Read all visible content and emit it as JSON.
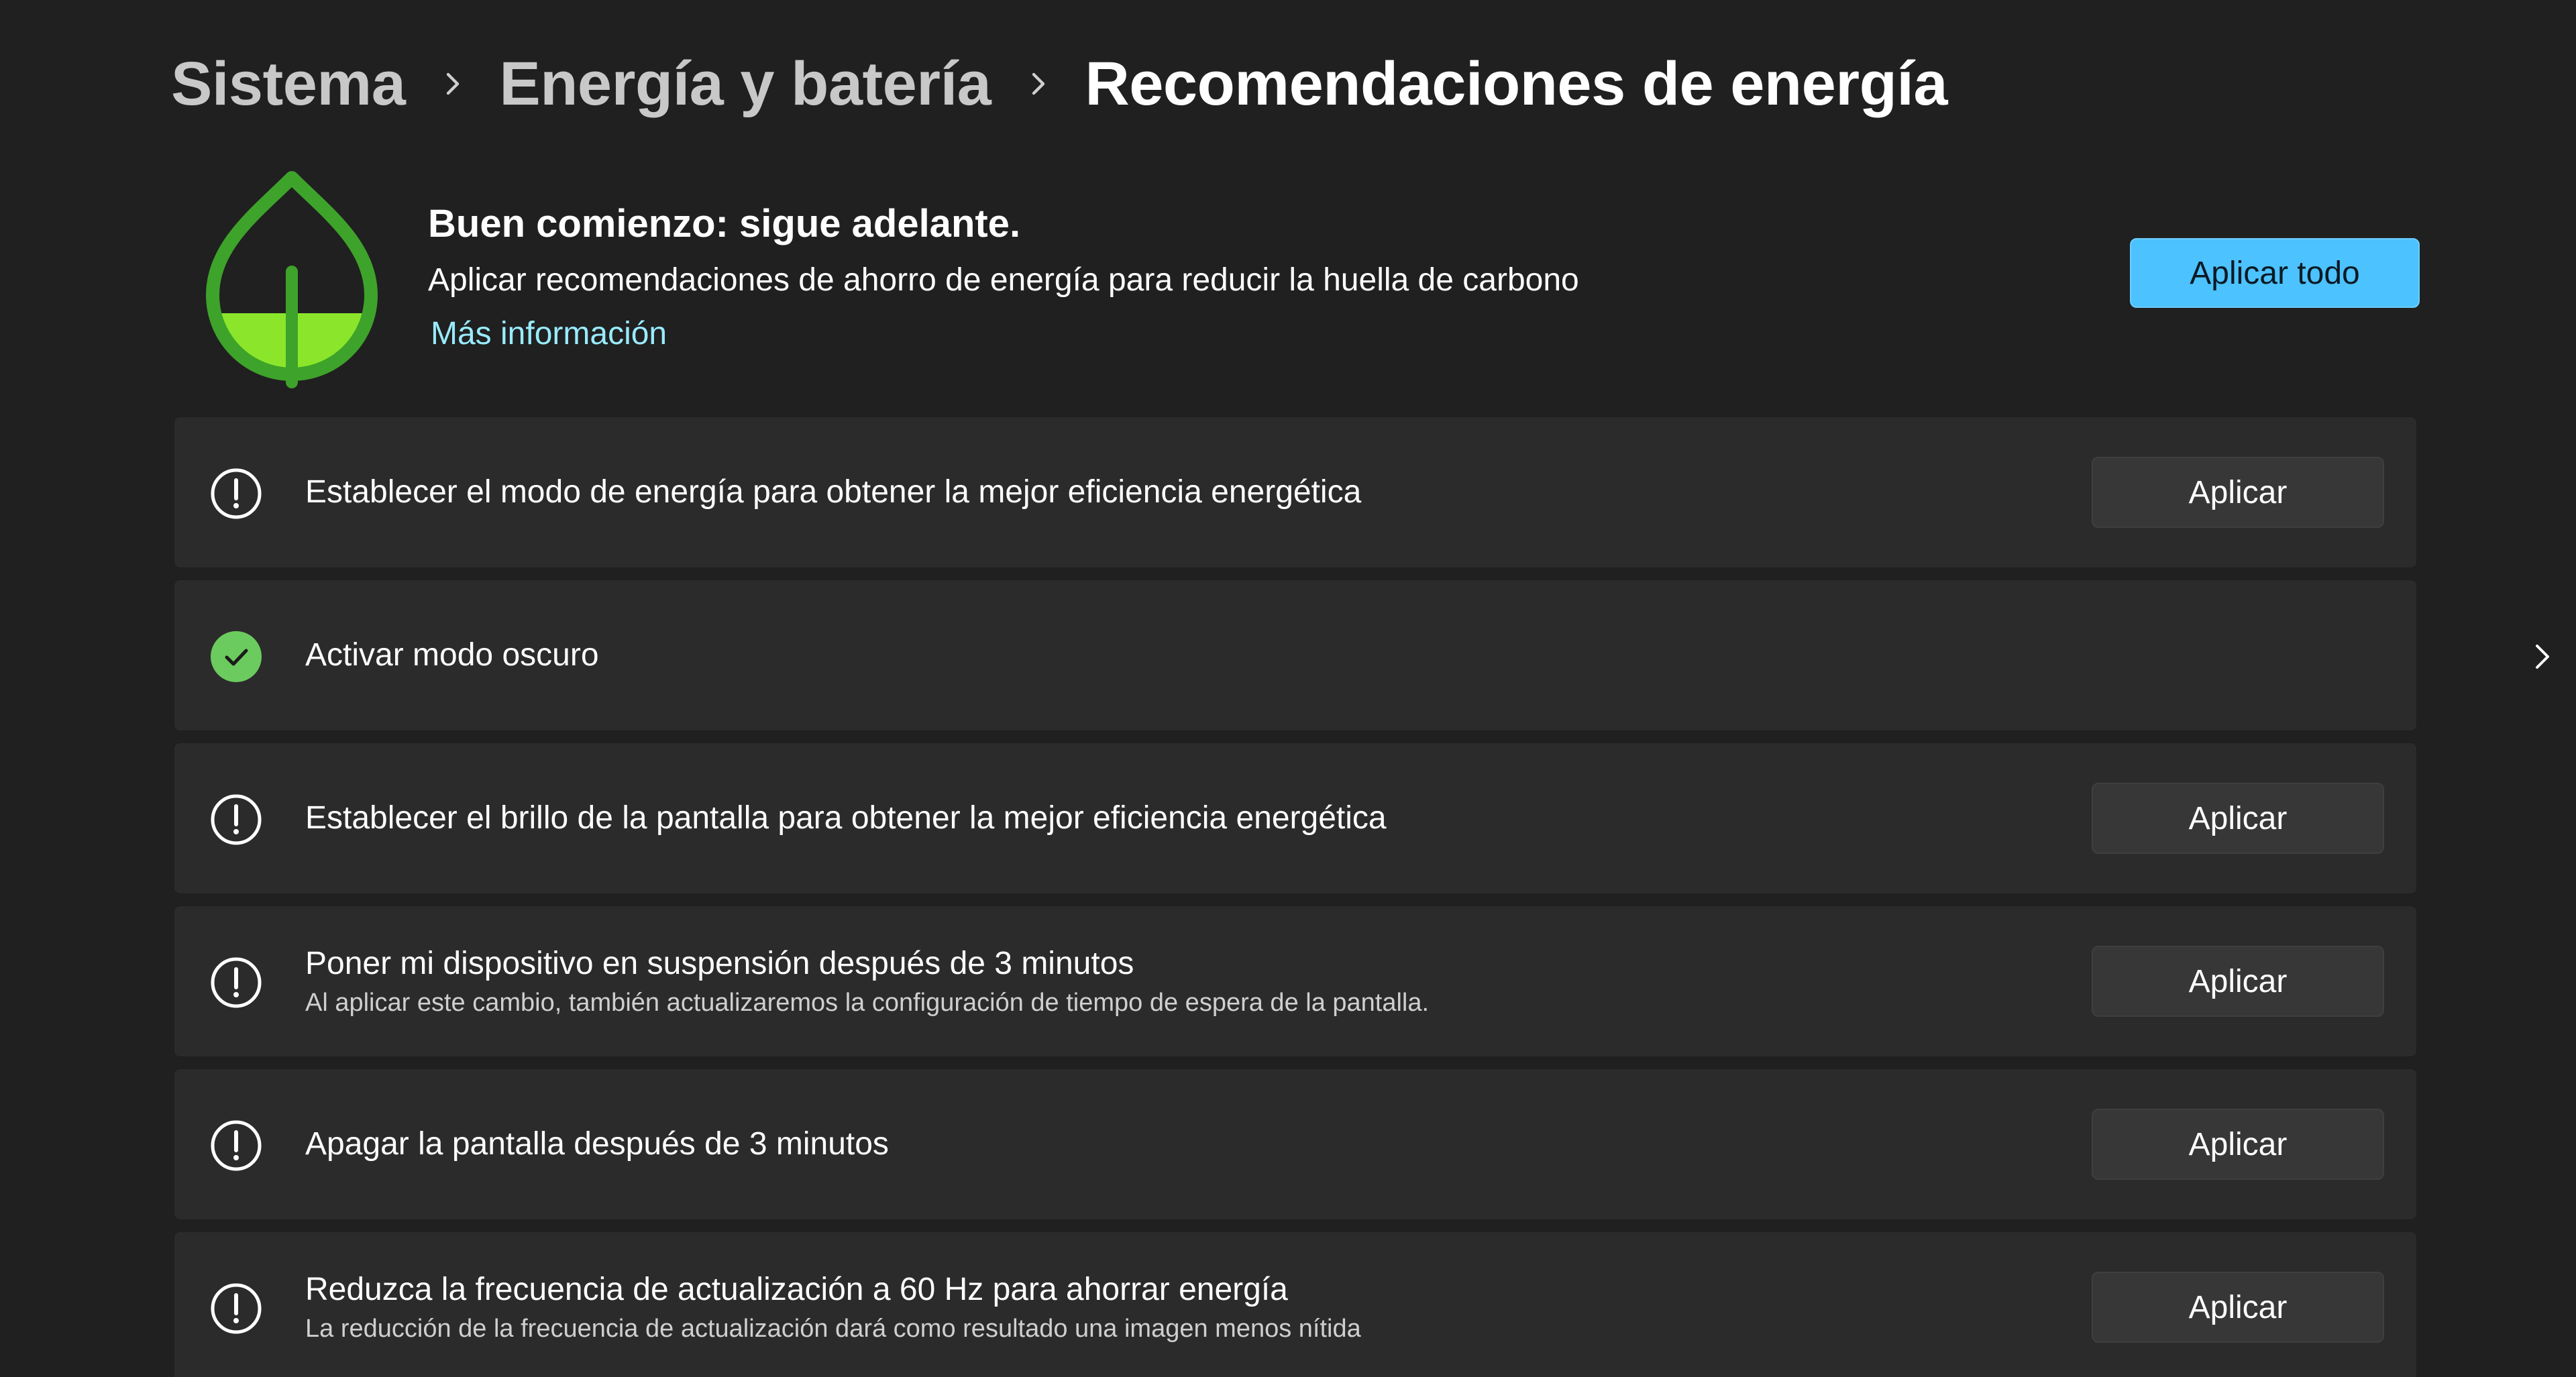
{
  "breadcrumb": {
    "items": [
      "Sistema",
      "Energía y batería",
      "Recomendaciones de energía"
    ]
  },
  "banner": {
    "title": "Buen comienzo: sigue adelante.",
    "description": "Aplicar recomendaciones de ahorro de energía para reducir la huella de carbono",
    "link": "Más información",
    "apply_all_label": "Aplicar todo",
    "icon": "leaf-icon"
  },
  "recommendations": [
    {
      "title": "Establecer el modo de energía para obtener la mejor eficiencia energética",
      "status": "pending",
      "icon": "warning-circle-icon",
      "action": "Aplicar"
    },
    {
      "title": "Activar modo oscuro",
      "status": "applied",
      "icon": "checkmark-circle-icon",
      "action_icon": "chevron-right-icon"
    },
    {
      "title": "Establecer el brillo de la pantalla para obtener la mejor eficiencia energética",
      "status": "pending",
      "icon": "warning-circle-icon",
      "action": "Aplicar"
    },
    {
      "title": "Poner mi dispositivo en suspensión después de 3 minutos",
      "subtitle": "Al aplicar este cambio, también actualizaremos la configuración de tiempo de espera de la pantalla.",
      "status": "pending",
      "icon": "warning-circle-icon",
      "action": "Aplicar"
    },
    {
      "title": "Apagar la pantalla después de 3 minutos",
      "status": "pending",
      "icon": "warning-circle-icon",
      "action": "Aplicar"
    },
    {
      "title": "Reduzca la frecuencia de actualización a 60 Hz para ahorrar energía",
      "subtitle": "La reducción de la frecuencia de actualización dará como resultado una imagen menos nítida",
      "status": "pending",
      "icon": "warning-circle-icon",
      "action": "Aplicar"
    }
  ],
  "colors": {
    "background": "#202020",
    "card": "#2b2b2b",
    "accent": "#4cc2ff",
    "link": "#99ebff",
    "success": "#6ccb5f",
    "leaf": "#3ea32a",
    "leaf_fill": "#8be62b"
  }
}
